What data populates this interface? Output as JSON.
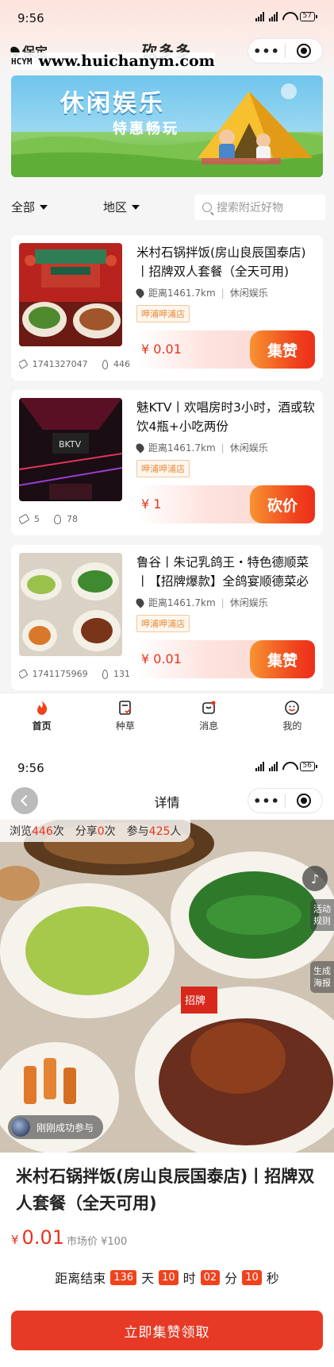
{
  "colors": {
    "accent": "#e8341c",
    "button_gradient_start": "#f79331",
    "button_gradient_end": "#ec2f1b",
    "cta": "#e63a26"
  },
  "screen1": {
    "status": {
      "time": "9:56",
      "battery": "57"
    },
    "location": "保定",
    "app_title": "砍多多",
    "capsule": {
      "more_icon": "more-dots-icon",
      "target_icon": "target-icon"
    },
    "watermark": {
      "logo": "HCYM",
      "url": "www.huichanym.com"
    },
    "banner": {
      "title": "休闲娱乐",
      "subtitle": "特惠畅玩"
    },
    "filters": {
      "all": "全部",
      "region": "地区",
      "search_placeholder": "搜索附近好物"
    },
    "cards": [
      {
        "title": "米村石锅拌饭(房山良辰国泰店)丨招牌双人套餐（全天可用)",
        "distance": "距离1461.7km",
        "category": "休闲娱乐",
        "shop": "呷浦呷浦店",
        "price": "¥ 0.01",
        "action": "集赞",
        "views": "1741327047",
        "heat": "446"
      },
      {
        "title": "魅KTV丨欢唱房时3小时，酒或软饮4瓶+小吃两份",
        "distance": "距离1461.7km",
        "category": "休闲娱乐",
        "shop": "呷浦呷浦店",
        "price": "¥ 1",
        "action": "砍价",
        "views": "5",
        "heat": "78"
      },
      {
        "title": "鲁谷丨朱记乳鸽王・特色德顺菜丨【招牌爆款】全鸽宴顺德菜必",
        "distance": "距离1461.7km",
        "category": "休闲娱乐",
        "shop": "呷浦呷浦店",
        "price": "¥ 0.01",
        "action": "集赞",
        "views": "1741175969",
        "heat": "131"
      }
    ],
    "tabs": [
      {
        "label": "首页",
        "icon": "home-flame-icon"
      },
      {
        "label": "种草",
        "icon": "clipboard-check-icon"
      },
      {
        "label": "消息",
        "icon": "message-bag-icon"
      },
      {
        "label": "我的",
        "icon": "profile-smile-icon"
      }
    ]
  },
  "screen2": {
    "status": {
      "time": "9:56",
      "battery": "56"
    },
    "title": "详情",
    "stats": {
      "views_prefix": "浏览",
      "views": "446",
      "views_suffix": "次",
      "shares_prefix": "分享",
      "shares": "0",
      "shares_suffix": "次",
      "joined_prefix": "参与",
      "joined": "425",
      "joined_suffix": "人"
    },
    "side_buttons": {
      "rules": "活动规则",
      "poster": "生成海报"
    },
    "joined_toast": "刚刚成功参与",
    "product_title": "米村石锅拌饭(房山良辰国泰店)丨招牌双人套餐（全天可用)",
    "price": {
      "currency": "¥",
      "value": "0.01",
      "market": "市场价 ¥100"
    },
    "countdown": {
      "label": "距离结束",
      "days": "136",
      "days_unit": "天",
      "hours": "10",
      "hours_unit": "时",
      "minutes": "02",
      "minutes_unit": "分",
      "seconds": "10",
      "seconds_unit": "秒"
    },
    "cta": "立即集赞领取"
  }
}
